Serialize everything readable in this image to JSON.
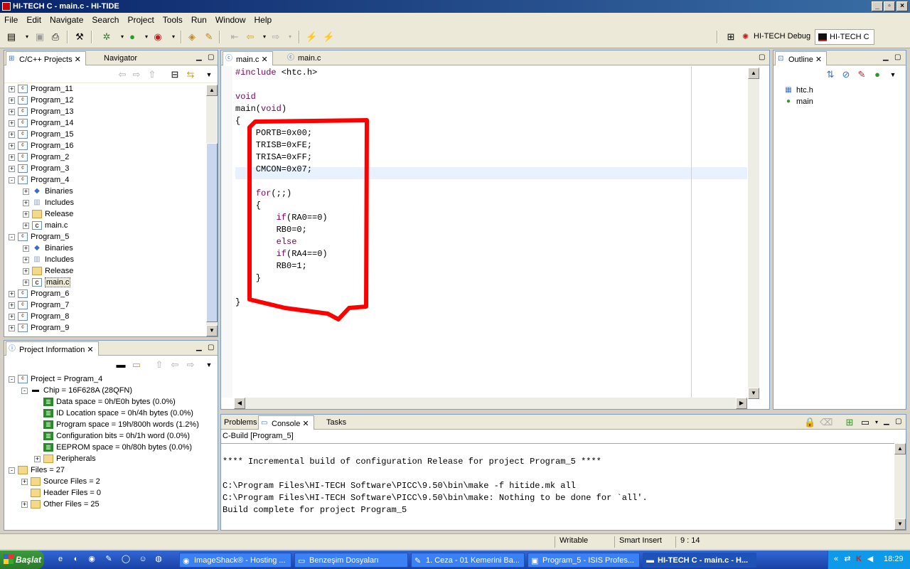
{
  "window": {
    "title": "HI-TECH C - main.c - HI-TIDE"
  },
  "menu": [
    "File",
    "Edit",
    "Navigate",
    "Search",
    "Project",
    "Tools",
    "Run",
    "Window",
    "Help"
  ],
  "perspectives": {
    "debug": "HI-TECH Debug",
    "c": "HI-TECH C"
  },
  "projects_panel": {
    "tab_active": "C/C++ Projects",
    "tab_other": "Navigator",
    "tree": [
      {
        "label": "Program_11",
        "level": 0,
        "exp": "+",
        "icon": "project"
      },
      {
        "label": "Program_12",
        "level": 0,
        "exp": "+",
        "icon": "project"
      },
      {
        "label": "Program_13",
        "level": 0,
        "exp": "+",
        "icon": "project"
      },
      {
        "label": "Program_14",
        "level": 0,
        "exp": "+",
        "icon": "project"
      },
      {
        "label": "Program_15",
        "level": 0,
        "exp": "+",
        "icon": "project"
      },
      {
        "label": "Program_16",
        "level": 0,
        "exp": "+",
        "icon": "project"
      },
      {
        "label": "Program_2",
        "level": 0,
        "exp": "+",
        "icon": "project"
      },
      {
        "label": "Program_3",
        "level": 0,
        "exp": "+",
        "icon": "project"
      },
      {
        "label": "Program_4",
        "level": 0,
        "exp": "-",
        "icon": "project"
      },
      {
        "label": "Binaries",
        "level": 1,
        "exp": "+",
        "icon": "binaries"
      },
      {
        "label": "Includes",
        "level": 1,
        "exp": "+",
        "icon": "includes"
      },
      {
        "label": "Release",
        "level": 1,
        "exp": "+",
        "icon": "folder"
      },
      {
        "label": "main.c",
        "level": 1,
        "exp": "+",
        "icon": "cfile"
      },
      {
        "label": "Program_5",
        "level": 0,
        "exp": "-",
        "icon": "project"
      },
      {
        "label": "Binaries",
        "level": 1,
        "exp": "+",
        "icon": "binaries"
      },
      {
        "label": "Includes",
        "level": 1,
        "exp": "+",
        "icon": "includes"
      },
      {
        "label": "Release",
        "level": 1,
        "exp": "+",
        "icon": "folder"
      },
      {
        "label": "main.c",
        "level": 1,
        "exp": "+",
        "icon": "cfile",
        "selected": true
      },
      {
        "label": "Program_6",
        "level": 0,
        "exp": "+",
        "icon": "project"
      },
      {
        "label": "Program_7",
        "level": 0,
        "exp": "+",
        "icon": "project"
      },
      {
        "label": "Program_8",
        "level": 0,
        "exp": "+",
        "icon": "project"
      },
      {
        "label": "Program_9",
        "level": 0,
        "exp": "+",
        "icon": "project"
      }
    ]
  },
  "info_panel": {
    "tab": "Project Information",
    "tree": [
      {
        "label": "Project = Program_4",
        "level": 0,
        "exp": "-",
        "icon": "project"
      },
      {
        "label": "Chip = 16F628A (28QFN)",
        "level": 1,
        "exp": "-",
        "icon": "chip"
      },
      {
        "label": "Data space = 0h/E0h bytes (0.0%)",
        "level": 2,
        "exp": "",
        "icon": "mem"
      },
      {
        "label": "ID Location space = 0h/4h bytes (0.0%)",
        "level": 2,
        "exp": "",
        "icon": "mem"
      },
      {
        "label": "Program space = 19h/800h words (1.2%)",
        "level": 2,
        "exp": "",
        "icon": "mem"
      },
      {
        "label": "Configuration bits = 0h/1h word (0.0%)",
        "level": 2,
        "exp": "",
        "icon": "mem"
      },
      {
        "label": "EEPROM space = 0h/80h bytes (0.0%)",
        "level": 2,
        "exp": "",
        "icon": "mem"
      },
      {
        "label": "Peripherals",
        "level": 2,
        "exp": "+",
        "icon": "folder"
      },
      {
        "label": "Files = 27",
        "level": 0,
        "exp": "-",
        "icon": "folder"
      },
      {
        "label": "Source Files = 2",
        "level": 1,
        "exp": "+",
        "icon": "folder"
      },
      {
        "label": "Header Files = 0",
        "level": 1,
        "exp": "",
        "icon": "folder"
      },
      {
        "label": "Other Files = 25",
        "level": 1,
        "exp": "+",
        "icon": "folder"
      }
    ]
  },
  "editor": {
    "tabs": [
      "main.c",
      "main.c"
    ],
    "lines": [
      {
        "t": "#include <htc.h>",
        "kw": "#include",
        "rest": " <htc.h>"
      },
      {
        "t": ""
      },
      {
        "t": "void",
        "kw": "void",
        "rest": ""
      },
      {
        "t": "main(void)",
        "pre": "main(",
        "kw2": "void",
        "post": ")"
      },
      {
        "t": "{"
      },
      {
        "t": "    PORTB=0x00;"
      },
      {
        "t": "    TRISB=0xFE;"
      },
      {
        "t": "    TRISA=0xFF;"
      },
      {
        "t": "    CMCON=0x07;"
      },
      {
        "t": ""
      },
      {
        "t": "    for(;;)",
        "indent": "    ",
        "kw": "for",
        "rest": "(;;)"
      },
      {
        "t": "    {"
      },
      {
        "t": "        if(RA0==0)",
        "indent": "        ",
        "kw": "if",
        "rest": "(RA0==0)"
      },
      {
        "t": "        RB0=0;"
      },
      {
        "t": "        else",
        "indent": "        ",
        "kw": "else",
        "rest": ""
      },
      {
        "t": "        if(RA4==0)",
        "indent": "        ",
        "kw": "if",
        "rest": "(RA4==0)"
      },
      {
        "t": "        RB0=1;"
      },
      {
        "t": "    }"
      },
      {
        "t": ""
      },
      {
        "t": "}"
      }
    ]
  },
  "outline": {
    "tab": "Outline",
    "items": [
      "htc.h",
      "main"
    ]
  },
  "bottom_panel": {
    "tabs": [
      "Problems",
      "Console",
      "Tasks"
    ],
    "console_title": "C-Build [Program_5]",
    "console_lines": [
      "",
      "**** Incremental build of configuration Release for project Program_5 ****",
      "",
      "C:\\Program Files\\HI-TECH Software\\PICC\\9.50\\bin\\make -f hitide.mk all",
      "C:\\Program Files\\HI-TECH Software\\PICC\\9.50\\bin\\make: Nothing to be done for `all'.",
      "Build complete for project Program_5"
    ]
  },
  "statusbar": {
    "writable": "Writable",
    "insert": "Smart Insert",
    "position": "9 : 14"
  },
  "taskbar": {
    "start": "Başlat",
    "tasks": [
      "ImageShack® - Hosting ...",
      "Benzeşim Dosyaları",
      "1. Ceza - 01 Kemerini Ba...",
      "Program_5 - ISIS Profes...",
      "HI-TECH C - main.c - H..."
    ],
    "clock": "18:29"
  },
  "colors": {
    "keyword": "#7f0055",
    "annotation": "#ff0000",
    "titlebar": "#0a246a",
    "taskbar": "#245edb"
  }
}
